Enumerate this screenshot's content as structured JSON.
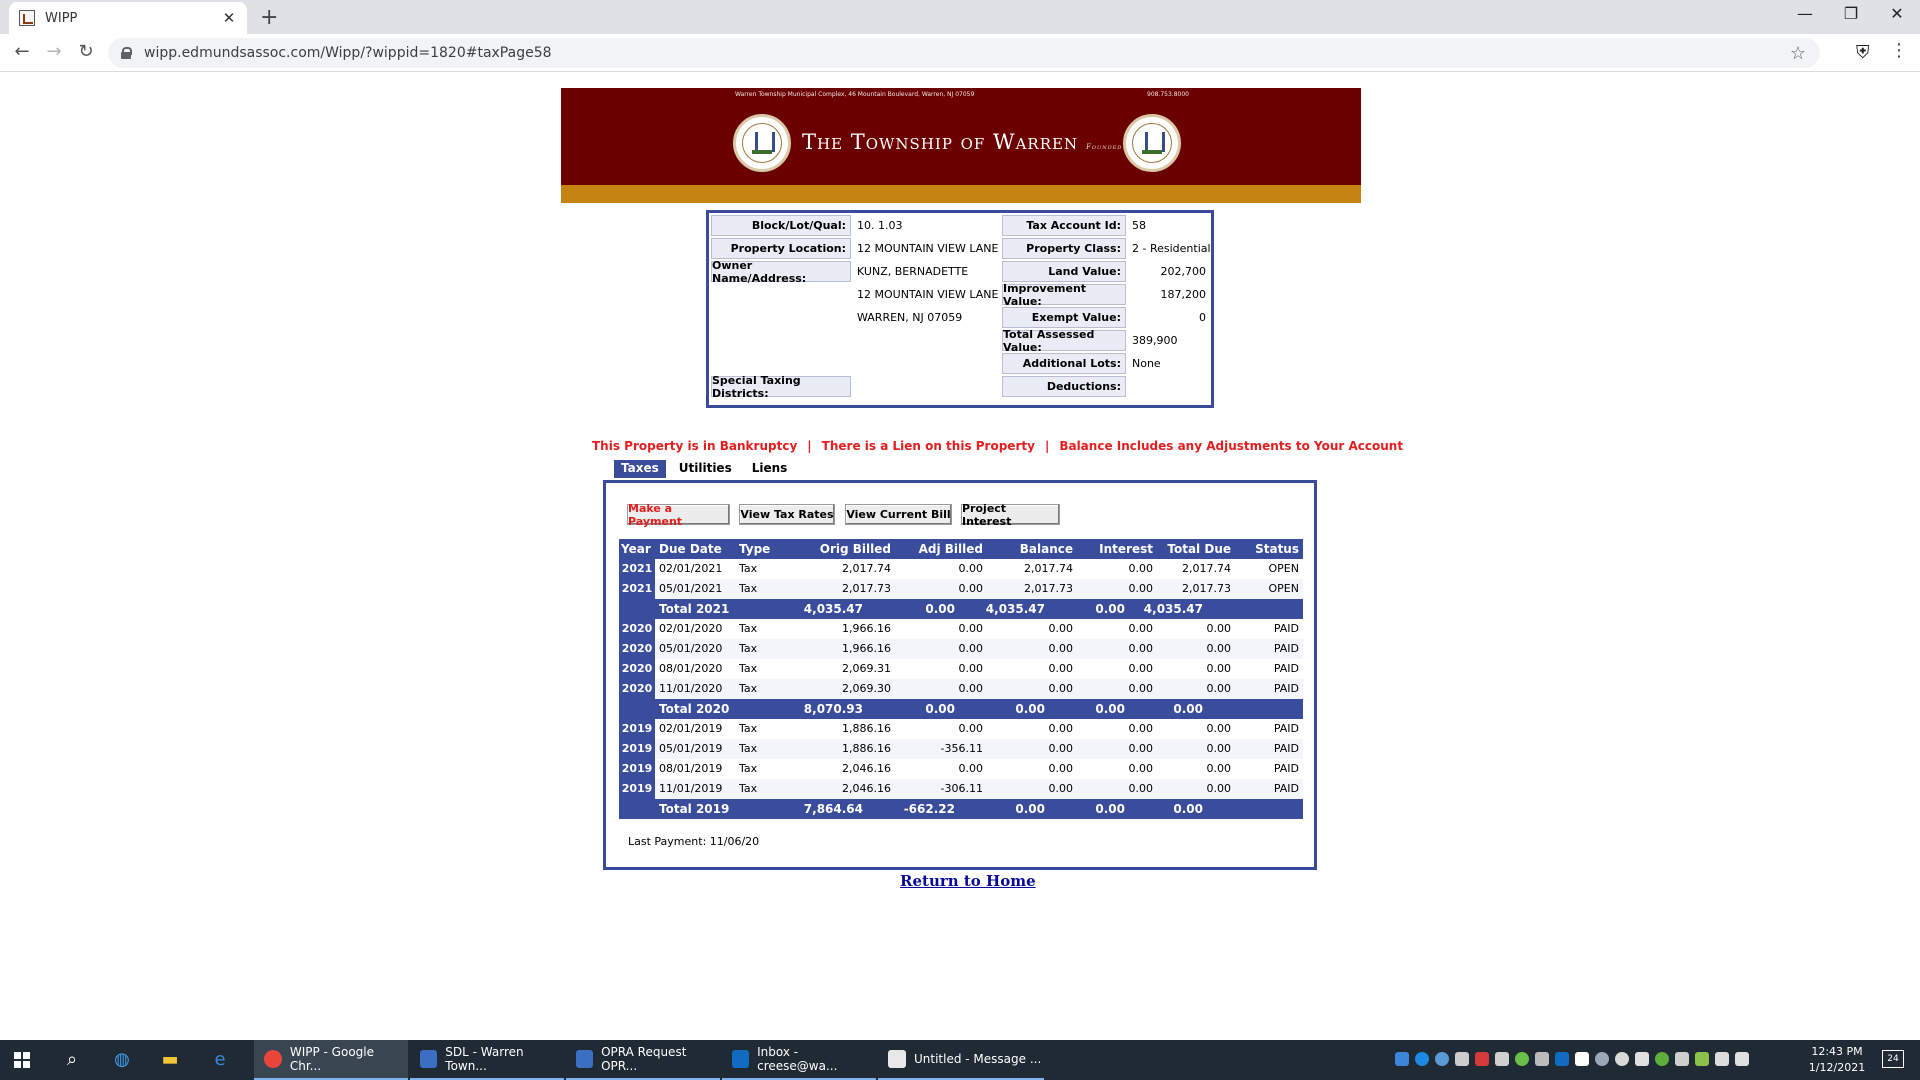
{
  "browser": {
    "tab_title": "WIPP",
    "url": "wipp.edmundsassoc.com/Wipp/?wippid=1820#taxPage58"
  },
  "banner": {
    "address": "Warren Township Municipal Complex, 46 Mountain Boulevard, Warren, NJ 07059",
    "phone": "908.753.8000",
    "title": "The Township of Warren",
    "founded": "Founded 1806"
  },
  "info": {
    "block_lot_label": "Block/Lot/Qual:",
    "block_lot_value": "10.    1.03",
    "property_location_label": "Property Location:",
    "property_location_value": "12 MOUNTAIN VIEW LANE",
    "owner_label": "Owner Name/Address:",
    "owner_name": "KUNZ, BERNADETTE",
    "owner_addr1": "12 MOUNTAIN VIEW LANE",
    "owner_addr2": "WARREN, NJ 07059",
    "special_districts_label": "Special Taxing Districts:",
    "tax_account_label": "Tax Account Id:",
    "tax_account_value": "58",
    "property_class_label": "Property Class:",
    "property_class_value": "2 - Residential",
    "land_value_label": "Land Value:",
    "land_value": "202,700",
    "improvement_label": "Improvement Value:",
    "improvement_value": "187,200",
    "exempt_label": "Exempt Value:",
    "exempt_value": "0",
    "total_assessed_label": "Total Assessed Value:",
    "total_assessed_value": "389,900",
    "additional_lots_label": "Additional Lots:",
    "additional_lots_value": "None",
    "deductions_label": "Deductions:"
  },
  "alerts": {
    "bankruptcy": "This Property is in Bankruptcy",
    "lien": "There is a Lien on this Property",
    "balance": "Balance Includes any Adjustments to Your Account",
    "separator": "|"
  },
  "tabs": [
    "Taxes",
    "Utilities",
    "Liens"
  ],
  "buttons": {
    "make_payment": "Make a Payment",
    "view_tax_rates": "View Tax Rates",
    "view_current_bill": "View Current Bill",
    "project_interest": "Project Interest"
  },
  "grid": {
    "headers": [
      "Year",
      "Due Date",
      "Type",
      "Orig Billed",
      "Adj Billed",
      "Balance",
      "Interest",
      "Total Due",
      "Status"
    ],
    "rows": [
      {
        "kind": "row",
        "year": "2021",
        "due": "02/01/2021",
        "type": "Tax",
        "orig": "2,017.74",
        "adj": "0.00",
        "bal": "2,017.74",
        "int": "0.00",
        "total": "2,017.74",
        "status": "OPEN"
      },
      {
        "kind": "row",
        "year": "2021",
        "due": "05/01/2021",
        "type": "Tax",
        "orig": "2,017.73",
        "adj": "0.00",
        "bal": "2,017.73",
        "int": "0.00",
        "total": "2,017.73",
        "status": "OPEN"
      },
      {
        "kind": "total",
        "label": "Total 2021",
        "orig": "4,035.47",
        "adj": "0.00",
        "bal": "4,035.47",
        "int": "0.00",
        "total": "4,035.47"
      },
      {
        "kind": "row",
        "year": "2020",
        "due": "02/01/2020",
        "type": "Tax",
        "orig": "1,966.16",
        "adj": "0.00",
        "bal": "0.00",
        "int": "0.00",
        "total": "0.00",
        "status": "PAID"
      },
      {
        "kind": "row",
        "year": "2020",
        "due": "05/01/2020",
        "type": "Tax",
        "orig": "1,966.16",
        "adj": "0.00",
        "bal": "0.00",
        "int": "0.00",
        "total": "0.00",
        "status": "PAID"
      },
      {
        "kind": "row",
        "year": "2020",
        "due": "08/01/2020",
        "type": "Tax",
        "orig": "2,069.31",
        "adj": "0.00",
        "bal": "0.00",
        "int": "0.00",
        "total": "0.00",
        "status": "PAID"
      },
      {
        "kind": "row",
        "year": "2020",
        "due": "11/01/2020",
        "type": "Tax",
        "orig": "2,069.30",
        "adj": "0.00",
        "bal": "0.00",
        "int": "0.00",
        "total": "0.00",
        "status": "PAID"
      },
      {
        "kind": "total",
        "label": "Total 2020",
        "orig": "8,070.93",
        "adj": "0.00",
        "bal": "0.00",
        "int": "0.00",
        "total": "0.00"
      },
      {
        "kind": "row",
        "year": "2019",
        "due": "02/01/2019",
        "type": "Tax",
        "orig": "1,886.16",
        "adj": "0.00",
        "bal": "0.00",
        "int": "0.00",
        "total": "0.00",
        "status": "PAID"
      },
      {
        "kind": "row",
        "year": "2019",
        "due": "05/01/2019",
        "type": "Tax",
        "orig": "1,886.16",
        "adj": "-356.11",
        "bal": "0.00",
        "int": "0.00",
        "total": "0.00",
        "status": "PAID"
      },
      {
        "kind": "row",
        "year": "2019",
        "due": "08/01/2019",
        "type": "Tax",
        "orig": "2,046.16",
        "adj": "0.00",
        "bal": "0.00",
        "int": "0.00",
        "total": "0.00",
        "status": "PAID"
      },
      {
        "kind": "row",
        "year": "2019",
        "due": "11/01/2019",
        "type": "Tax",
        "orig": "2,046.16",
        "adj": "-306.11",
        "bal": "0.00",
        "int": "0.00",
        "total": "0.00",
        "status": "PAID"
      },
      {
        "kind": "total",
        "label": "Total 2019",
        "orig": "7,864.64",
        "adj": "-662.22",
        "bal": "0.00",
        "int": "0.00",
        "total": "0.00"
      }
    ]
  },
  "last_payment": "Last Payment: 11/06/20",
  "return_link": "Return to Home",
  "taskbar": {
    "apps": [
      "WIPP - Google Chr...",
      "SDL - Warren Town...",
      "OPRA Request OPR...",
      "Inbox - creese@wa...",
      "Untitled - Message ..."
    ],
    "time": "12:43 PM",
    "date": "1/12/2021",
    "notifications": "24"
  },
  "colors": {
    "banner": "#6b0000",
    "banner_gold": "#c58312",
    "table_header": "#3a4c9c",
    "alert_red": "#e31e1e",
    "link_blue": "#0a0a9a"
  }
}
